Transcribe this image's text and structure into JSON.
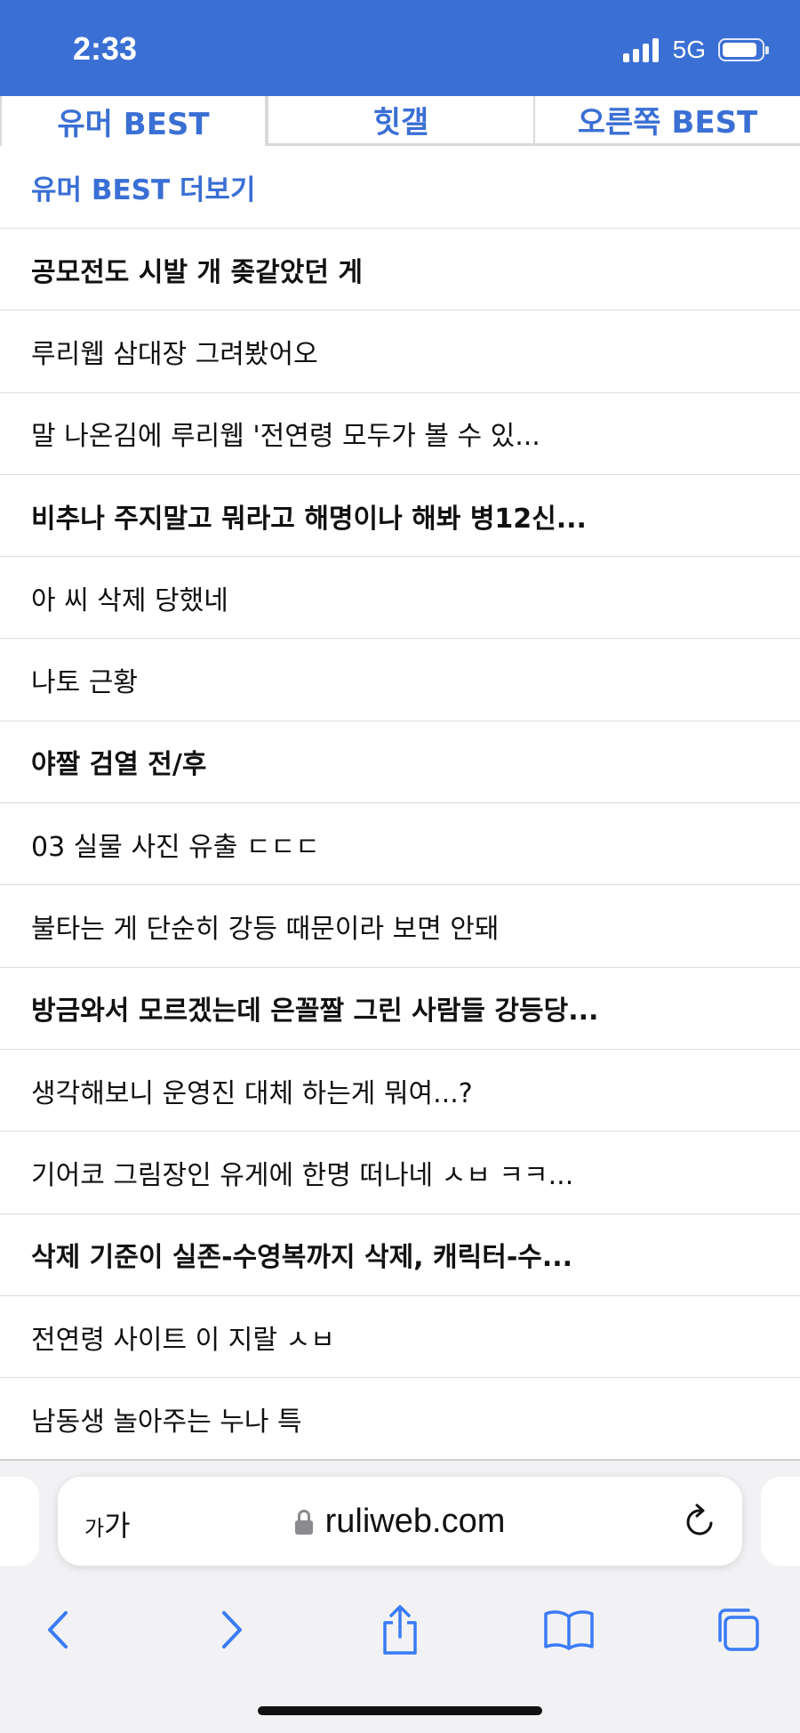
{
  "status": {
    "time": "2:33",
    "network": "5G",
    "signal_bars": 4,
    "battery_level": 0.8
  },
  "colors": {
    "accent": "#3a6fd4",
    "text": "#111111",
    "divider": "#dcdcdc"
  },
  "tabs": [
    {
      "label": "유머 BEST",
      "active": true
    },
    {
      "label": "힛갤",
      "active": false
    },
    {
      "label": "오른쪽 BEST",
      "active": false
    }
  ],
  "more_link": "유머 BEST 더보기",
  "posts": [
    {
      "title": "공모전도 시발 개 좆같았던 게",
      "bold": true
    },
    {
      "title": "루리웹 삼대장 그려봤어오",
      "bold": false
    },
    {
      "title": "말 나온김에 루리웹 '전연령 모두가 볼 수 있...",
      "bold": false
    },
    {
      "title": "비추나 주지말고 뭐라고 해명이나 해봐 병12신...",
      "bold": true
    },
    {
      "title": "아 씨 삭제 당했네",
      "bold": false
    },
    {
      "title": "나토 근황",
      "bold": false
    },
    {
      "title": "야짤 검열 전/후",
      "bold": true
    },
    {
      "title": "03 실물 사진 유출 ㄷㄷㄷ",
      "bold": false
    },
    {
      "title": "불타는 게 단순히 강등 때문이라 보면 안돼",
      "bold": false
    },
    {
      "title": "방금와서 모르겠는데 은꼴짤 그린 사람들 강등당...",
      "bold": true
    },
    {
      "title": "생각해보니 운영진 대체 하는게 뭐여...?",
      "bold": false
    },
    {
      "title": "기어코 그림장인 유게에 한명 떠나네 ㅅㅂ ㅋㅋ...",
      "bold": false
    },
    {
      "title": "삭제 기준이 실존-수영복까지 삭제, 캐릭터-수...",
      "bold": true
    },
    {
      "title": "전연령 사이트 이 지랄 ㅅㅂ",
      "bold": false
    },
    {
      "title": "남동생 놀아주는 누나 특",
      "bold": false
    }
  ],
  "browser": {
    "text_size_label_small": "가",
    "text_size_label_large": "가",
    "url": "ruliweb.com",
    "icons": {
      "lock": "lock-icon",
      "reload": "reload-icon",
      "back": "back-icon",
      "forward": "forward-icon",
      "share": "share-icon",
      "bookmarks": "bookmarks-icon",
      "tabs": "tabs-icon"
    }
  }
}
